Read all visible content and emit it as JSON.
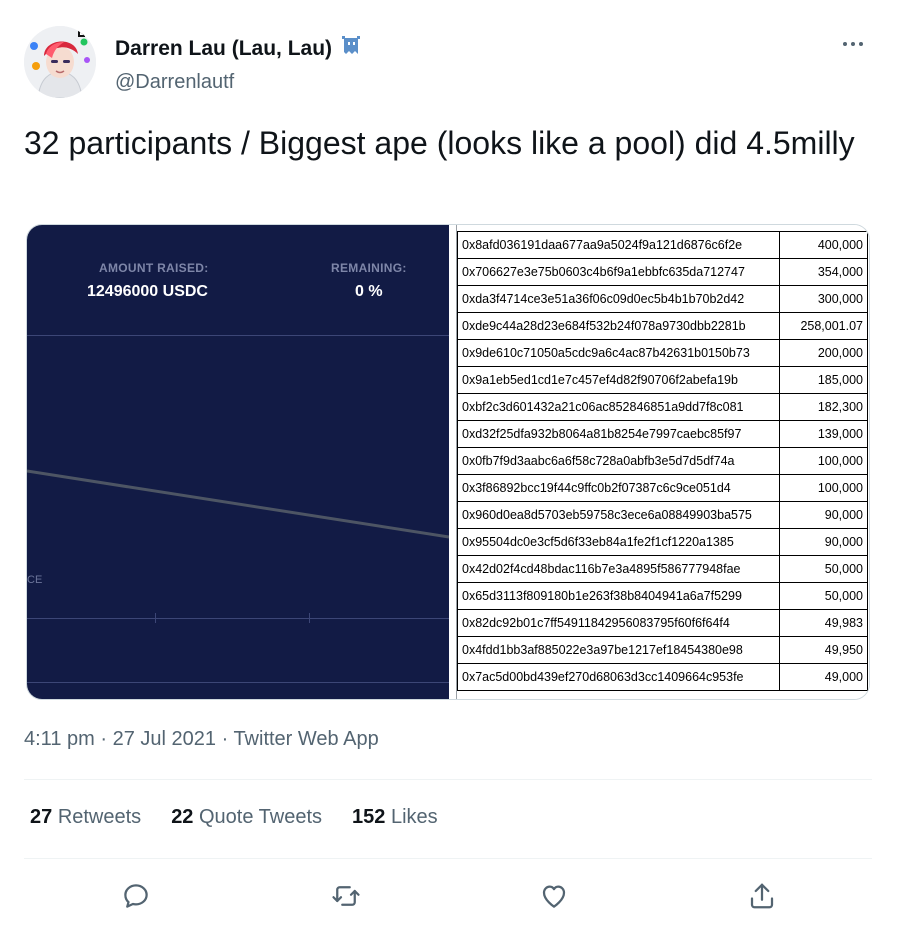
{
  "author": {
    "name": "Darren Lau (Lau, Lau)",
    "handle": "@Darrenlautf"
  },
  "tweet": {
    "text": "32 participants / Biggest ape (looks like a pool) did 4.5milly"
  },
  "dashboard": {
    "amount_label": "AMOUNT RAISED:",
    "amount_value": "12496000 USDC",
    "remaining_label": "REMAINING:",
    "remaining_value": "0 %",
    "edge_text": "CE"
  },
  "sheet": {
    "rows": [
      {
        "address": "0x8afd036191daa677aa9a5024f9a121d6876c6f2e",
        "amount": "400,000"
      },
      {
        "address": "0x706627e3e75b0603c4b6f9a1ebbfc635da712747",
        "amount": "354,000"
      },
      {
        "address": "0xda3f4714ce3e51a36f06c09d0ec5b4b1b70b2d42",
        "amount": "300,000"
      },
      {
        "address": "0xde9c44a28d23e684f532b24f078a9730dbb2281b",
        "amount": "258,001.07"
      },
      {
        "address": "0x9de610c71050a5cdc9a6c4ac87b42631b0150b73",
        "amount": "200,000"
      },
      {
        "address": "0x9a1eb5ed1cd1e7c457ef4d82f90706f2abefa19b",
        "amount": "185,000"
      },
      {
        "address": "0xbf2c3d601432a21c06ac852846851a9dd7f8c081",
        "amount": "182,300"
      },
      {
        "address": "0xd32f25dfa932b8064a81b8254e7997caebc85f97",
        "amount": "139,000"
      },
      {
        "address": "0x0fb7f9d3aabc6a6f58c728a0abfb3e5d7d5df74a",
        "amount": "100,000"
      },
      {
        "address": "0x3f86892bcc19f44c9ffc0b2f07387c6c9ce051d4",
        "amount": "100,000"
      },
      {
        "address": "0x960d0ea8d5703eb59758c3ece6a08849903ba575",
        "amount": "90,000"
      },
      {
        "address": "0x95504dc0e3cf5d6f33eb84a1fe2f1cf1220a1385",
        "amount": "90,000"
      },
      {
        "address": "0x42d02f4cd48bdac116b7e3a4895f586777948fae",
        "amount": "50,000"
      },
      {
        "address": "0x65d3113f809180b1e263f38b8404941a6a7f5299",
        "amount": "50,000"
      },
      {
        "address": "0x82dc92b01c7ff54911842956083795f60f6f64f4",
        "amount": "49,983"
      },
      {
        "address": "0x4fdd1bb3af885022e3a97be1217ef18454380e98",
        "amount": "49,950"
      },
      {
        "address": "0x7ac5d00bd439ef270d68063d3cc1409664c953fe",
        "amount": "49,000"
      }
    ]
  },
  "meta": {
    "time": "4:11 pm",
    "separator": "·",
    "date": "27 Jul 2021",
    "client": "Twitter Web App"
  },
  "stats": {
    "retweets_count": "27",
    "retweets_label": "Retweets",
    "quotes_count": "22",
    "quotes_label": "Quote Tweets",
    "likes_count": "152",
    "likes_label": "Likes"
  },
  "icons": {
    "more": "more-icon",
    "reply": "reply-icon",
    "retweet": "retweet-icon",
    "like": "heart-icon",
    "share": "share-icon",
    "badge": "pixel-ghost-icon"
  },
  "colors": {
    "text": "#0f1419",
    "muted": "#536471",
    "dashboard_bg": "#121b45",
    "badge": "#5b8fc9"
  }
}
